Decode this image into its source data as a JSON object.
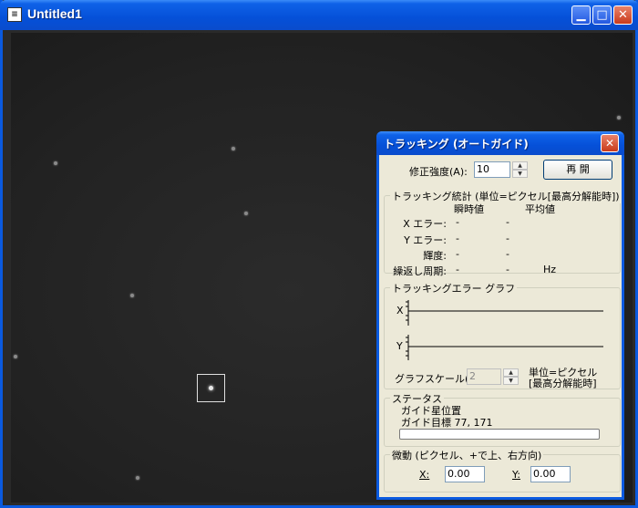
{
  "window": {
    "title": "Untitled1",
    "icon": "document-icon",
    "minimize_glyph": "▁",
    "maximize_glyph": "□",
    "close_glyph": "✕"
  },
  "dialog": {
    "title": "トラッキング (オートガイド)",
    "close_glyph": "✕",
    "correction_label": "修正強度(A):",
    "correction_value": "10",
    "restart_button": "再 開",
    "stats": {
      "title": "トラッキング統計 (単位=ピクセル[最高分解能時])",
      "col_instant": "瞬時値",
      "col_average": "平均値",
      "rows": [
        {
          "label": "X エラー:",
          "instant": "-",
          "average": "-",
          "unit": ""
        },
        {
          "label": "Y エラー:",
          "instant": "-",
          "average": "-",
          "unit": ""
        },
        {
          "label": "輝度:",
          "instant": "-",
          "average": "-",
          "unit": ""
        },
        {
          "label": "繰返し周期:",
          "instant": "-",
          "average": "-",
          "unit": "Hz"
        }
      ]
    },
    "graph": {
      "title": "トラッキングエラー グラフ",
      "x_label": "X",
      "y_label": "Y",
      "scale_label": "グラフスケール(G):",
      "scale_value": "2",
      "unit_line1": "単位=ピクセル",
      "unit_line2": "[最高分解能時]"
    },
    "status": {
      "title": "ステータス",
      "line1": "ガイド星位置",
      "line2": "ガイド目標 77, 171"
    },
    "nudge": {
      "title": "微動 (ピクセル、+で上、右方向)",
      "x_label": "X:",
      "x_value": "0.00",
      "y_label": "Y:",
      "y_value": "0.00"
    }
  },
  "colors": {
    "titlebar": "#0550d8",
    "dialog_bg": "#ece9d8",
    "starfield": "#222222",
    "close_button": "#c93a1b"
  }
}
